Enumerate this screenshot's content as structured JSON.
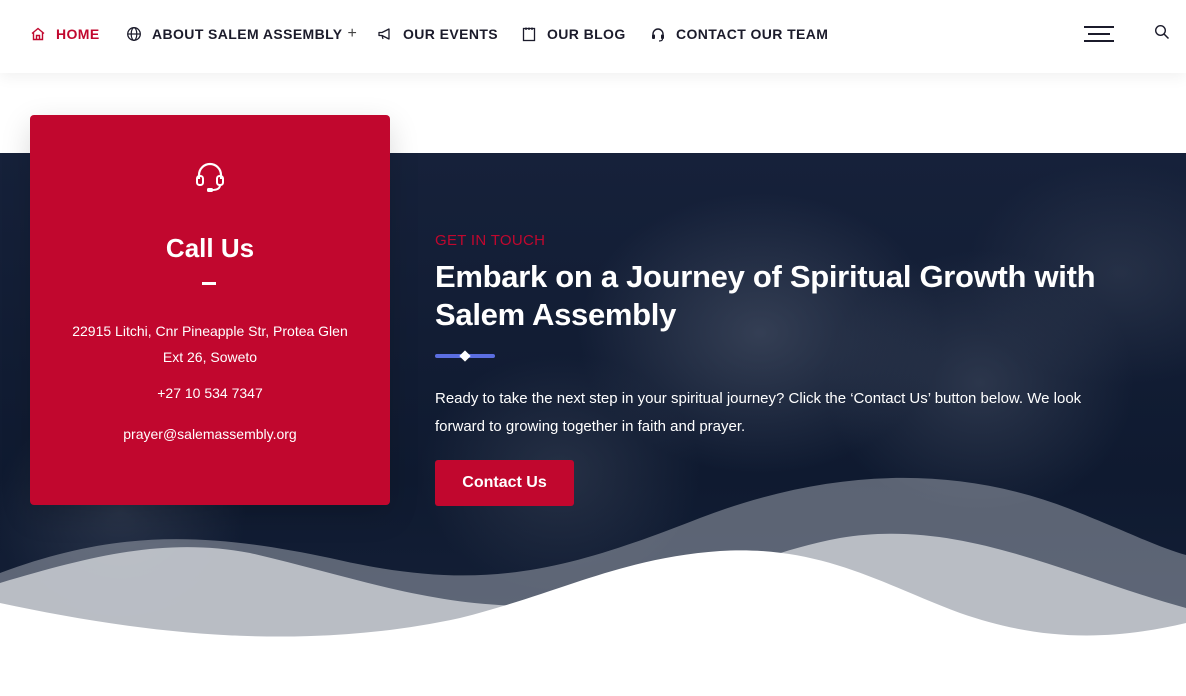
{
  "nav": {
    "items": [
      {
        "label": "HOME",
        "icon": "home-icon",
        "active": true
      },
      {
        "label": "ABOUT SALEM ASSEMBLY",
        "icon": "globe-icon",
        "has_submenu": true
      },
      {
        "label": "OUR EVENTS",
        "icon": "megaphone-icon"
      },
      {
        "label": "OUR BLOG",
        "icon": "notepad-icon"
      },
      {
        "label": "CONTACT OUR TEAM",
        "icon": "headset-icon"
      }
    ],
    "submenu_indicator": "+",
    "menu_icon": "hamburger-icon",
    "search_icon": "search-icon"
  },
  "card": {
    "icon": "headset-icon",
    "title": "Call Us",
    "address": "22915 Litchi, Cnr Pineapple Str, Protea Glen Ext 26, Soweto",
    "phone": "+27 10 534 7347",
    "email": "prayer@salemassembly.org"
  },
  "hero": {
    "eyebrow": "GET IN TOUCH",
    "headline": "Embark on a Journey of Spiritual Growth with Salem Assembly",
    "description": "Ready to take the next step in your spiritual journey? Click the ‘Contact Us’ button below. We look forward to growing together in faith and prayer.",
    "cta_label": "Contact Us"
  },
  "colors": {
    "accent": "#c1072e",
    "dark_bg": "#0f1a30",
    "underline": "#5b6ee1",
    "text_dark": "#1b1b2b"
  }
}
